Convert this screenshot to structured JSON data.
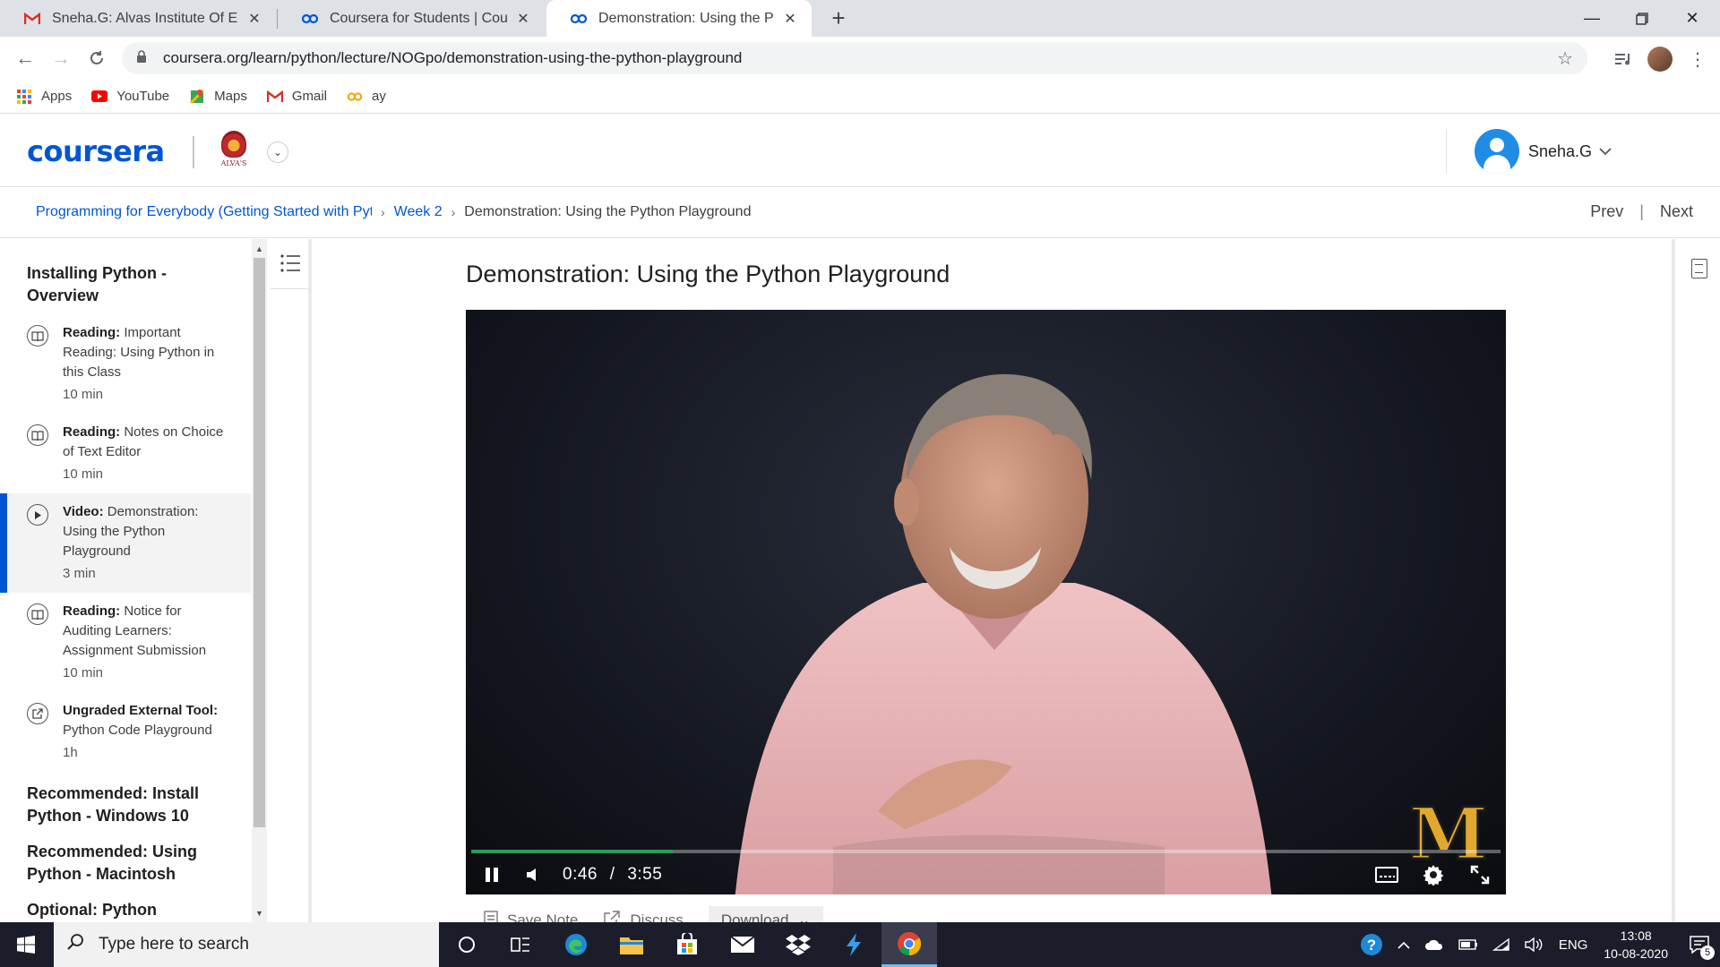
{
  "browser": {
    "tabs": [
      {
        "title": "Sneha.G: Alvas Institute Of Engineering",
        "icon": "gmail-icon"
      },
      {
        "title": "Coursera for Students | Coursera",
        "icon": "coursera-icon"
      },
      {
        "title": "Demonstration: Using the Python Playground",
        "icon": "coursera-icon"
      }
    ],
    "url": "coursera.org/learn/python/lecture/NOGpo/demonstration-using-the-python-playground",
    "bookmarks": [
      {
        "label": "Apps",
        "icon": "apps-grid-icon"
      },
      {
        "label": "YouTube",
        "icon": "youtube-icon"
      },
      {
        "label": "Maps",
        "icon": "maps-icon"
      },
      {
        "label": "Gmail",
        "icon": "gmail-icon"
      },
      {
        "label": "ay",
        "icon": "coursera-icon"
      }
    ]
  },
  "header": {
    "logo": "coursera",
    "institution_label": "ALVA'S",
    "user_name": "Sneha.G"
  },
  "breadcrumb": {
    "course": "Programming for Everybody (Getting Started with Python)",
    "week": "Week 2",
    "current": "Demonstration: Using the Python Playground",
    "prev": "Prev",
    "next": "Next"
  },
  "sidebar": {
    "section1_title": "Installing Python - Overview",
    "items": [
      {
        "kind": "Reading:",
        "title": "Important Reading: Using Python in this Class",
        "duration": "10 min",
        "icon": "reading-icon"
      },
      {
        "kind": "Reading:",
        "title": "Notes on Choice of Text Editor",
        "duration": "10 min",
        "icon": "reading-icon"
      },
      {
        "kind": "Video:",
        "title": "Demonstration: Using the Python Playground",
        "duration": "3 min",
        "icon": "play-icon"
      },
      {
        "kind": "Reading:",
        "title": "Notice for Auditing Learners: Assignment Submission",
        "duration": "10 min",
        "icon": "reading-icon"
      },
      {
        "kind": "Ungraded External Tool:",
        "title": "Python Code Playground",
        "duration": "1h",
        "icon": "external-tool-icon"
      }
    ],
    "section2_title": "Recommended: Install Python - Windows 10",
    "section3_title": "Recommended: Using Python - Macintosh",
    "section4_title": "Optional: Python"
  },
  "lecture": {
    "title": "Demonstration: Using the Python Playground",
    "video": {
      "current_time": "0:46",
      "separator": "/",
      "duration": "3:55",
      "progress_fraction": 0.196
    },
    "actions": {
      "save_note": "Save Note",
      "discuss": "Discuss",
      "download": "Download"
    }
  },
  "taskbar": {
    "search_placeholder": "Type here to search",
    "language": "ENG",
    "time": "13:08",
    "date": "10-08-2020",
    "notification_count": "5"
  },
  "colors": {
    "coursera_blue": "#0056d2",
    "progress_green": "#2a9d58",
    "michigan_maize": "#e0a82e"
  }
}
